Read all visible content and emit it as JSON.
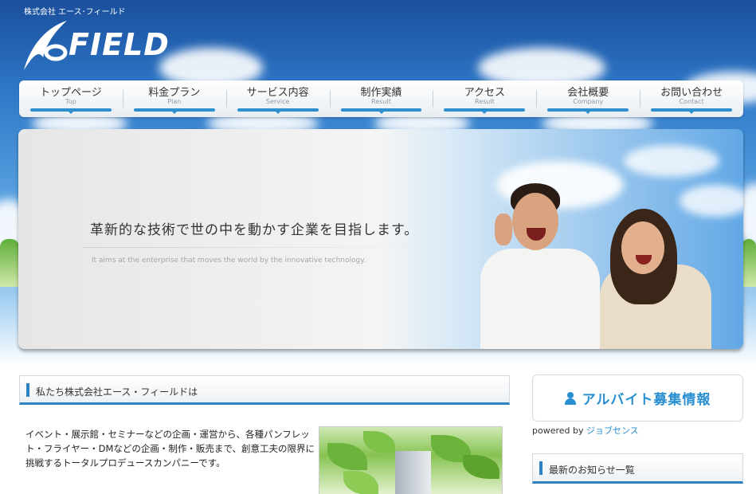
{
  "header": {
    "company_name": "株式会社 エース･フィールド",
    "logo_text": "FIELD"
  },
  "nav": {
    "items": [
      {
        "jp": "トップページ",
        "en": "Top"
      },
      {
        "jp": "料金プラン",
        "en": "Plan"
      },
      {
        "jp": "サービス内容",
        "en": "Service"
      },
      {
        "jp": "制作実績",
        "en": "Result"
      },
      {
        "jp": "アクセス",
        "en": "Result"
      },
      {
        "jp": "会社概要",
        "en": "Company"
      },
      {
        "jp": "お問い合わせ",
        "en": "Contact"
      }
    ]
  },
  "hero": {
    "title": "革新的な技術で世の中を動かす企業を目指します。",
    "subtitle": "It aims at the enterprise that moves the world by the innovative technology."
  },
  "main": {
    "section_title": "私たち株式会社エース・フィールドは",
    "intro_text": "イベント・展示館・セミナーなどの企画・運営から、各種パンフレット・フライヤー・DMなどの企画・制作・販売まで、創意工夫の限界に挑戦するトータルプロデュースカンパニーです。"
  },
  "sidebar": {
    "job_label": "アルバイト募集情報",
    "powered_prefix": "powered by",
    "powered_link": "ジョブセンス",
    "news_title": "最新のお知らせ一覧"
  },
  "colors": {
    "accent": "#2a83c7",
    "link": "#2a8fd0"
  }
}
